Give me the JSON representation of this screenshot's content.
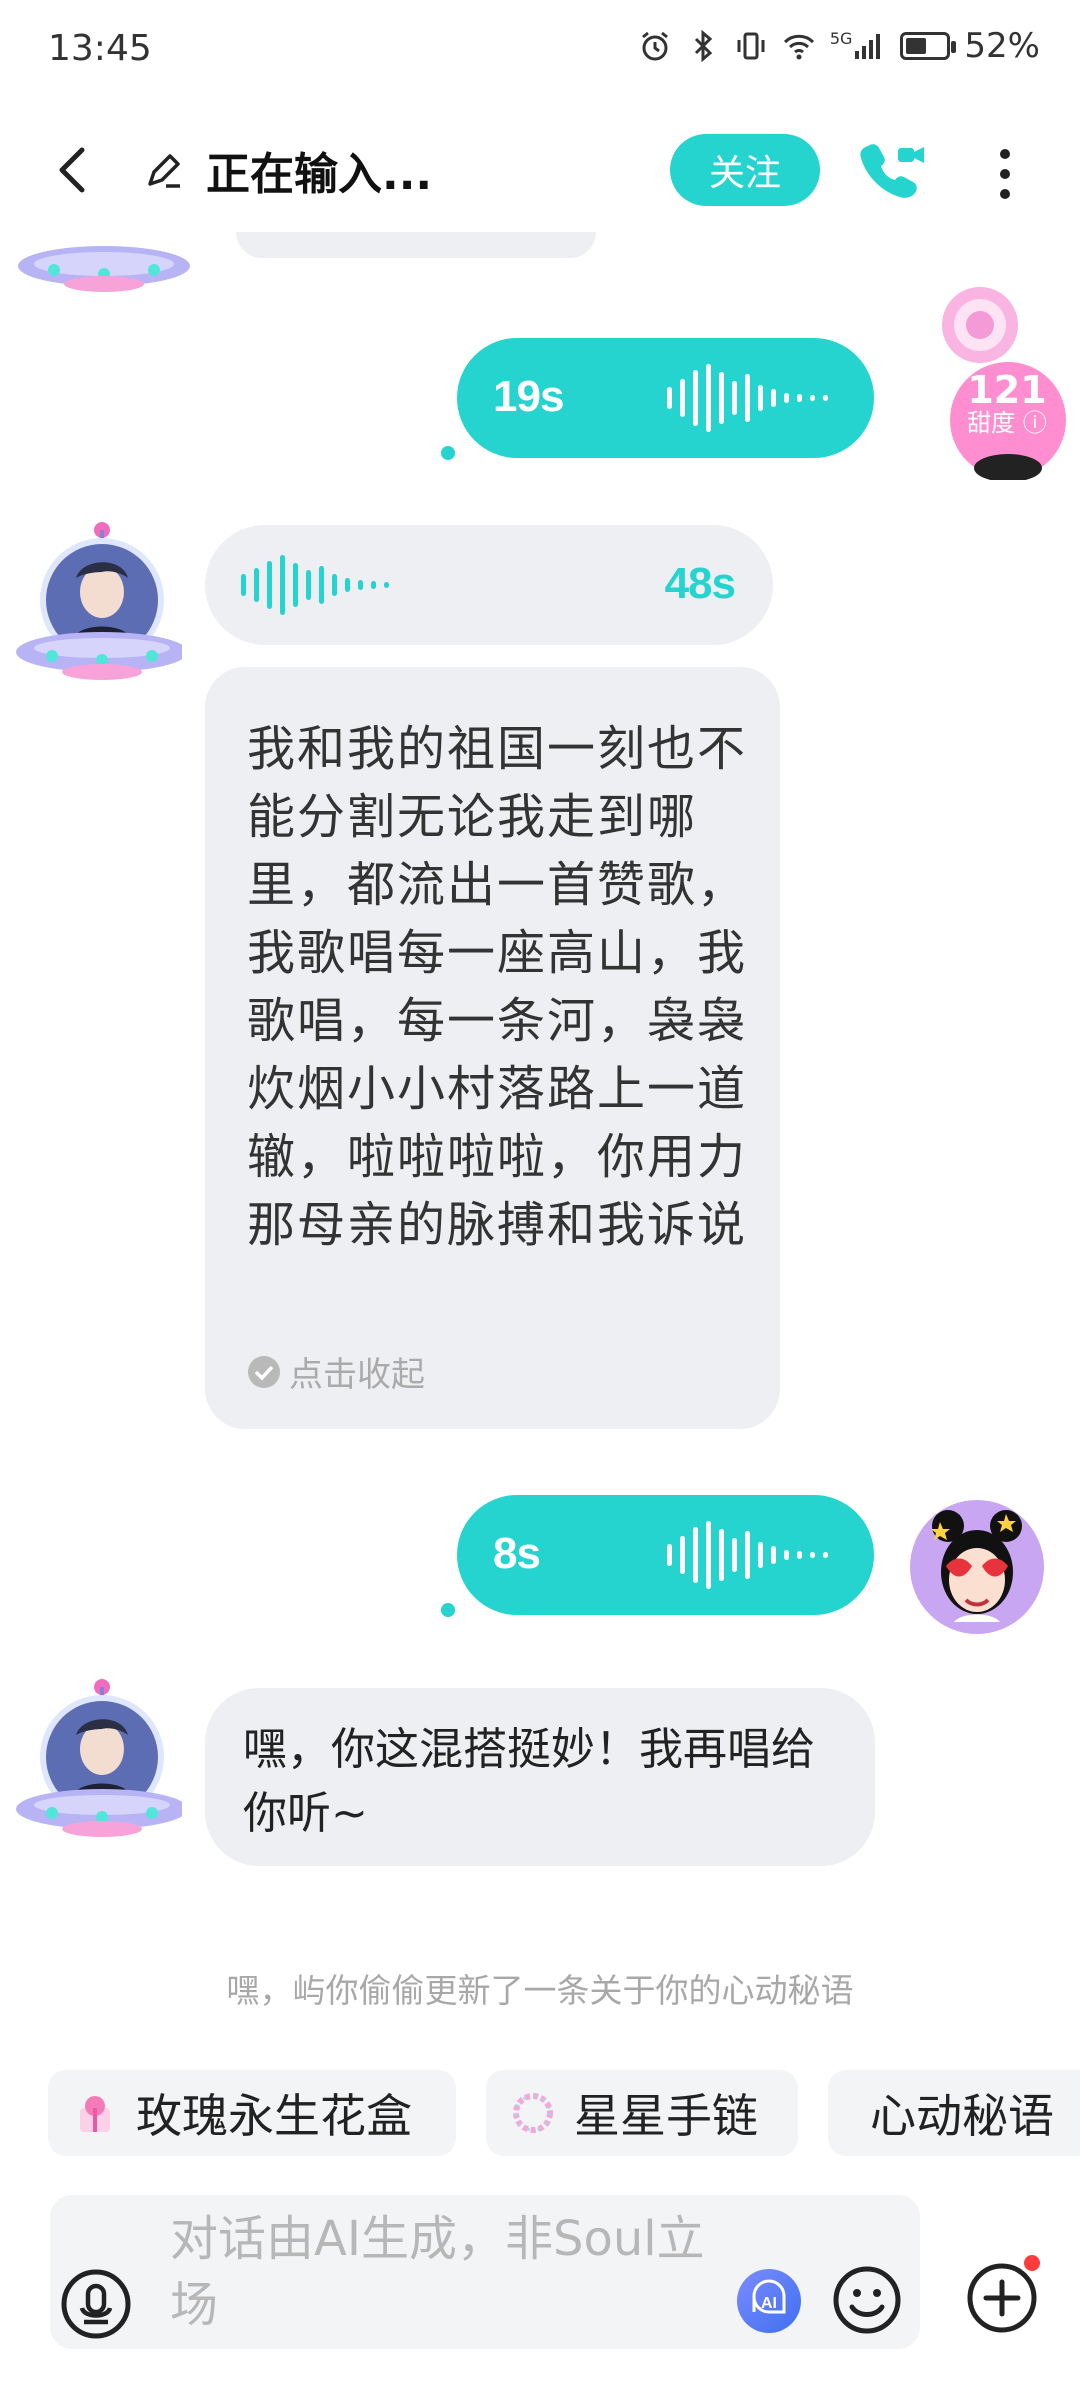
{
  "status_bar": {
    "time": "13:45",
    "network": "5G",
    "battery": "52%",
    "battery_level": 0.52,
    "icons": [
      "alarm-icon",
      "bluetooth-icon",
      "vibrate-icon",
      "wifi-icon",
      "signal-icon",
      "battery-icon"
    ]
  },
  "header": {
    "title": "正在输入...",
    "follow_label": "关注",
    "icons": [
      "back-icon",
      "edit-pen-icon",
      "video-call-icon",
      "more-icon"
    ]
  },
  "messages": {
    "voice_out_1": {
      "duration": "19s"
    },
    "voice_in_1": {
      "duration": "48s"
    },
    "transcript": {
      "text": "我和我的祖国一刻也不能分割无论我走到哪里，都流出一首赞歌，我歌唱每一座高山，我歌唱，每一条河，袅袅炊烟小小村落路上一道辙，啦啦啦啦，你用力那母亲的脉搏和我诉说",
      "collapse_label": "点击收起"
    },
    "voice_out_2": {
      "duration": "8s"
    },
    "reply": {
      "text": "嘿，你这混搭挺妙！我再唱给你听~"
    },
    "sweetness": {
      "value": "121",
      "label": "甜度"
    }
  },
  "notice": "嘿，屿你偷偷更新了一条关于你的心动秘语",
  "suggestions": [
    {
      "label": "玫瑰永生花盒",
      "icon": "rose-gift-box-icon"
    },
    {
      "label": "星星手链",
      "icon": "bracelet-icon"
    },
    {
      "label": "心动秘语",
      "icon": "heart-icon"
    }
  ],
  "input": {
    "placeholder": "对话由AI生成，非Soul立场"
  },
  "colors": {
    "accent": "#25d4cf",
    "bubble_in": "#eeeff2",
    "input_bg": "#f3f4f6"
  }
}
